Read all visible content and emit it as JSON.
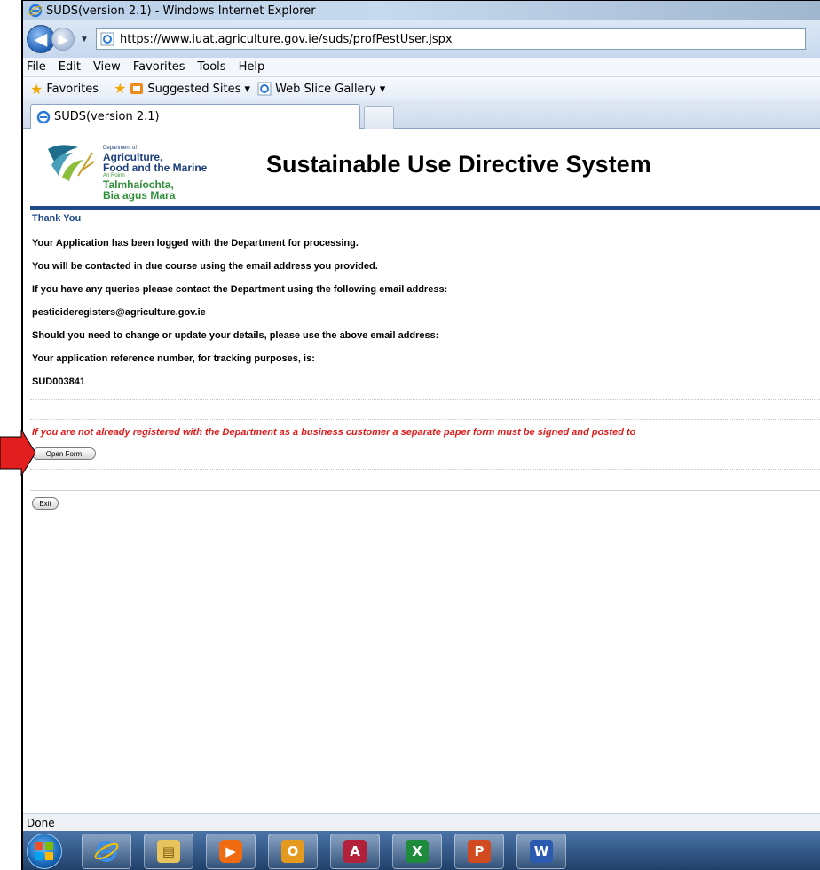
{
  "window": {
    "title": "SUDS(version 2.1) - Windows Internet Explorer",
    "url": "https://www.iuat.agriculture.gov.ie/suds/profPestUser.jspx"
  },
  "menu": [
    "File",
    "Edit",
    "View",
    "Favorites",
    "Tools",
    "Help"
  ],
  "favorites_bar": {
    "favorites": "Favorites",
    "suggested_sites": "Suggested Sites ▾",
    "web_slice_gallery": "Web Slice Gallery ▾"
  },
  "tab": {
    "label": "SUDS(version 2.1)"
  },
  "banner": {
    "dept_small_1": "Department of",
    "dept_line_1": "Agriculture,",
    "dept_line_2": "Food and the Marine",
    "dept_small_2": "An Roinn",
    "dept_line_3": "Talmhaíochta,",
    "dept_line_4": "Bia agus Mara",
    "system_title": "Sustainable Use Directive System"
  },
  "content": {
    "section_title": "Thank You",
    "lines": [
      "Your Application has been logged with the Department for processing.",
      "You will be contacted in due course using the email address you provided.",
      "If you have any queries please contact the Department using the following email address:",
      "pesticideregisters@agriculture.gov.ie",
      "Should you need to change or update your details, please use the above email address:",
      "Your application reference number, for tracking purposes, is:",
      "SUD003841"
    ],
    "warning": "If you are not already registered with the Department as a business customer a separate paper form must be signed and posted to",
    "open_form_label": "Open Form",
    "exit_label": "Exit"
  },
  "status": {
    "text": "Done"
  },
  "colors": {
    "accent_blue": "#1e4b86",
    "warning_red": "#e01b1b",
    "arrow_red": "#e21e1e"
  },
  "taskbar_icons": [
    "windows-start-icon",
    "internet-explorer-icon",
    "file-explorer-icon",
    "media-player-icon",
    "outlook-icon",
    "access-icon",
    "excel-icon",
    "powerpoint-icon",
    "word-icon"
  ]
}
